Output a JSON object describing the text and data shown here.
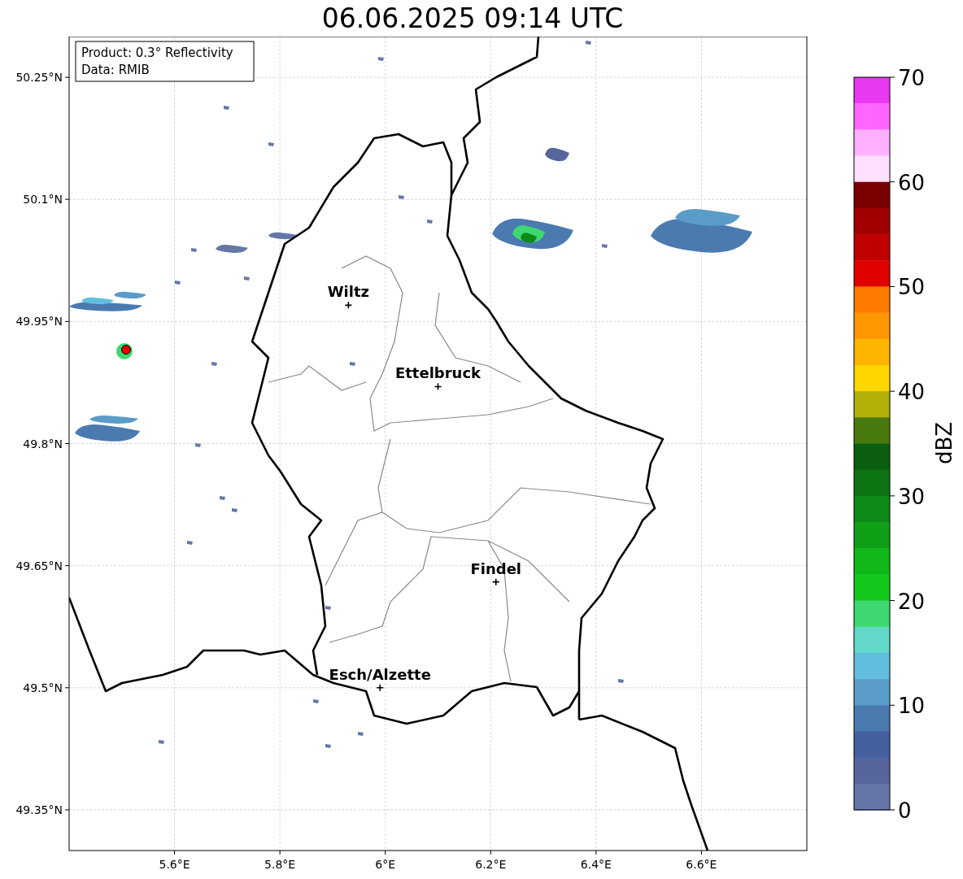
{
  "title": "06.06.2025 09:14 UTC",
  "info_box": [
    "Product: 0.3° Reflectivity",
    "Data: RMIB"
  ],
  "map": {
    "chart_data": {
      "type": "scatter",
      "grid": true,
      "xlim": [
        5.4,
        6.8
      ],
      "ylim": [
        49.3,
        50.3
      ],
      "xticks": [
        {
          "value": 5.6,
          "label": "5.6°E"
        },
        {
          "value": 5.8,
          "label": "5.8°E"
        },
        {
          "value": 6.0,
          "label": "6°E"
        },
        {
          "value": 6.2,
          "label": "6.2°E"
        },
        {
          "value": 6.4,
          "label": "6.4°E"
        },
        {
          "value": 6.6,
          "label": "6.6°E"
        }
      ],
      "yticks": [
        {
          "value": 49.35,
          "label": "49.35°N"
        },
        {
          "value": 49.5,
          "label": "49.5°N"
        },
        {
          "value": 49.65,
          "label": "49.65°N"
        },
        {
          "value": 49.8,
          "label": "49.8°N"
        },
        {
          "value": 49.95,
          "label": "49.95°N"
        },
        {
          "value": 50.1,
          "label": "50.1°N"
        },
        {
          "value": 50.25,
          "label": "50.25°N"
        }
      ],
      "x": [
        5.93,
        6.1,
        6.21,
        5.99
      ],
      "values": [
        49.97,
        49.87,
        49.63,
        49.5
      ],
      "annotations": [
        "Wiltz",
        "Ettelbruck",
        "Findel",
        "Esch/Alzette"
      ]
    }
  },
  "colorbar": {
    "label": "dBZ",
    "ticks": [
      "70",
      "60",
      "50",
      "40",
      "30",
      "20",
      "10",
      "0"
    ],
    "segments": [
      {
        "color": "#e838f0"
      },
      {
        "color": "#ff66ff"
      },
      {
        "color": "#ffb0ff"
      },
      {
        "color": "#ffe0ff"
      },
      {
        "color": "#7a0000"
      },
      {
        "color": "#a00000"
      },
      {
        "color": "#c00000"
      },
      {
        "color": "#e00000"
      },
      {
        "color": "#ff7a00"
      },
      {
        "color": "#ff9800"
      },
      {
        "color": "#ffb400"
      },
      {
        "color": "#ffd600"
      },
      {
        "color": "#b0b008"
      },
      {
        "color": "#487a10"
      },
      {
        "color": "#0a5e0e"
      },
      {
        "color": "#0c7412"
      },
      {
        "color": "#0e8a18"
      },
      {
        "color": "#10a018"
      },
      {
        "color": "#10b818"
      },
      {
        "color": "#12c81a"
      },
      {
        "color": "#3ed870"
      },
      {
        "color": "#62d8c8"
      },
      {
        "color": "#62bede"
      },
      {
        "color": "#5a9cc8"
      },
      {
        "color": "#4a7ab0"
      },
      {
        "color": "#4560a0"
      },
      {
        "color": "#56669c"
      },
      {
        "color": "#6577a8"
      }
    ]
  }
}
